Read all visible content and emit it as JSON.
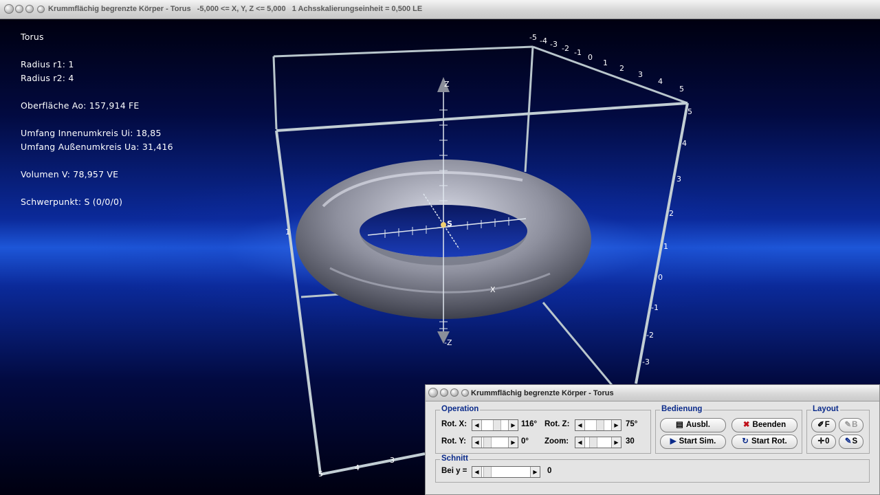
{
  "window": {
    "title": "Krummflächig begrenzte Körper - Torus   -5,000 <= X, Y, Z <= 5,000   1 Achsskalierungseinheit = 0,500 LE"
  },
  "info": {
    "name": "Torus",
    "radius_r1": "Radius r1: 1",
    "radius_r2": "Radius r2: 4",
    "surface": "Oberfläche Ao: 157,914 FE",
    "inner_circumference": "Umfang Innenumkreis Ui: 18,85",
    "outer_circumference": "Umfang Außenumkreis Ua: 31,416",
    "volume": "Volumen V: 78,957 VE",
    "centroid": "Schwerpunkt: S (0/0/0)"
  },
  "axes": {
    "z_pos": "Z",
    "z_neg": "-Z",
    "x": "X",
    "s_point": "S",
    "top_ticks": [
      "-5",
      "-4",
      "-3",
      "-2",
      "-1",
      "0",
      "1",
      "2",
      "3",
      "4",
      "5"
    ],
    "right_ticks": [
      "5",
      "4",
      "3",
      "2",
      "1",
      "0",
      "-1",
      "-2",
      "-3"
    ],
    "bottom_ticks": [
      "5",
      "4",
      "3"
    ],
    "left_tick": "1"
  },
  "control": {
    "title": "Krummflächig begrenzte Körper - Torus",
    "operation": {
      "title": "Operation",
      "rot_x_label": "Rot. X:",
      "rot_x_value": "116°",
      "rot_y_label": "Rot. Y:",
      "rot_y_value": "0°",
      "rot_z_label": "Rot. Z:",
      "rot_z_value": "75°",
      "zoom_label": "Zoom:",
      "zoom_value": "30"
    },
    "bedienung": {
      "title": "Bedienung",
      "ausbl": "Ausbl.",
      "beenden": "Beenden",
      "start_sim": "Start Sim.",
      "start_rot": "Start Rot."
    },
    "layout": {
      "title": "Layout",
      "f": "F",
      "b": "B",
      "zero": "0",
      "s": "S"
    },
    "schnitt": {
      "title": "Schnitt",
      "label": "Bei y =",
      "value": "0"
    }
  }
}
